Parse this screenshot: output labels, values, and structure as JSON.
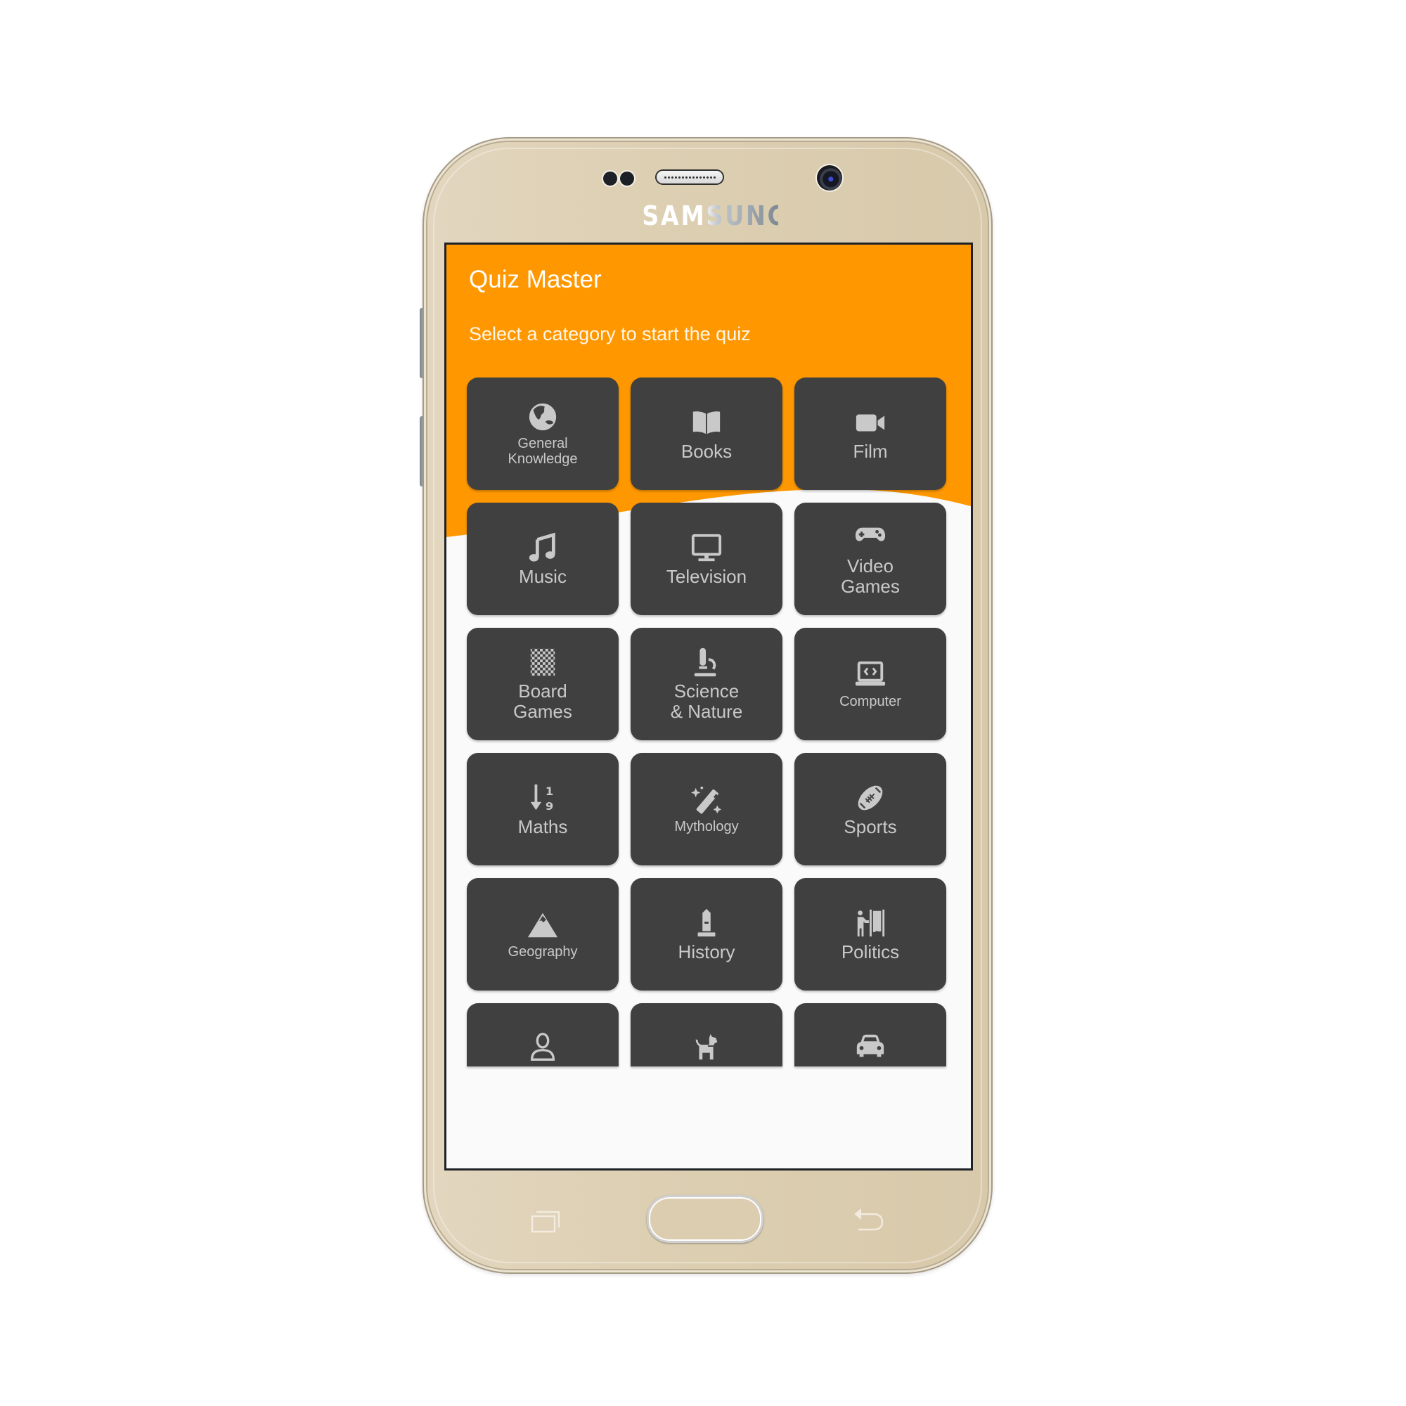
{
  "device": {
    "brand": "SAMSUNG",
    "body_color": "#DCCDB0"
  },
  "app": {
    "title": "Quiz Master",
    "subtitle": "Select a category to start the quiz",
    "accent_color": "#FF9800",
    "card_color": "#404040",
    "card_text_color": "#C9C9C9",
    "background_color": "#FAFAFA"
  },
  "categories": [
    {
      "label": "General\nKnowledge",
      "icon": "globe-icon",
      "small": true
    },
    {
      "label": "Books",
      "icon": "open-book-icon",
      "small": false
    },
    {
      "label": "Film",
      "icon": "video-camera-icon",
      "small": false
    },
    {
      "label": "Music",
      "icon": "music-note-icon",
      "small": false
    },
    {
      "label": "Television",
      "icon": "tv-monitor-icon",
      "small": false
    },
    {
      "label": "Video\nGames",
      "icon": "gamepad-icon",
      "small": false
    },
    {
      "label": "Board\nGames",
      "icon": "chessboard-icon",
      "small": false
    },
    {
      "label": "Science\n& Nature",
      "icon": "microscope-icon",
      "small": false
    },
    {
      "label": "Computer",
      "icon": "laptop-code-icon",
      "small": true
    },
    {
      "label": "Maths",
      "icon": "sort-numeric-down-icon",
      "small": false
    },
    {
      "label": "Mythology",
      "icon": "magic-wand-icon",
      "small": true
    },
    {
      "label": "Sports",
      "icon": "football-icon",
      "small": false
    },
    {
      "label": "Geography",
      "icon": "mountain-icon",
      "small": true
    },
    {
      "label": "History",
      "icon": "monument-icon",
      "small": false
    },
    {
      "label": "Politics",
      "icon": "voting-booth-icon",
      "small": false
    },
    {
      "label": "",
      "icon": "person-icon",
      "small": false
    },
    {
      "label": "",
      "icon": "dog-icon",
      "small": false
    },
    {
      "label": "",
      "icon": "car-icon",
      "small": false
    }
  ],
  "nav": {
    "recent_icon": "recent-apps-icon",
    "home_icon": "home-button",
    "back_icon": "back-arrow-icon"
  }
}
